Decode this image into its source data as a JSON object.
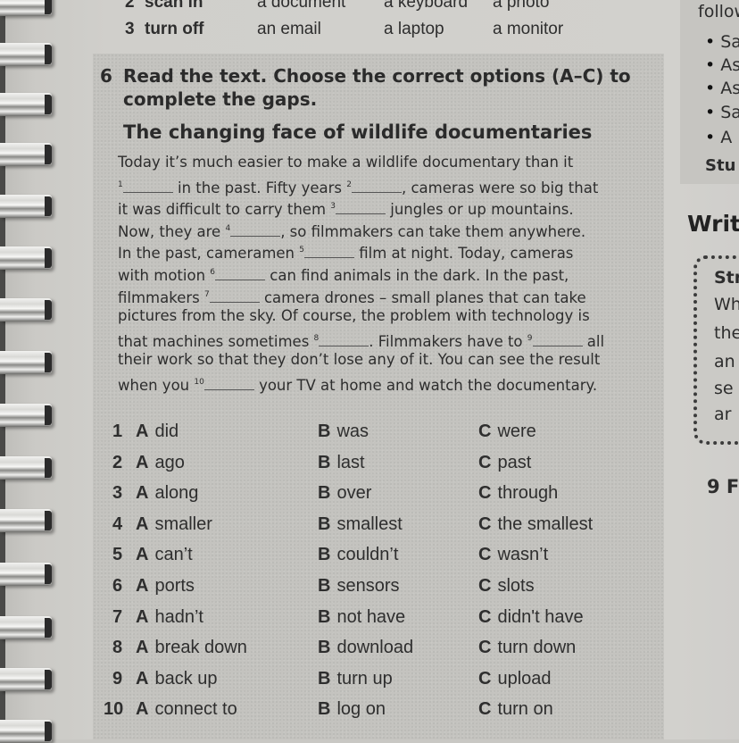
{
  "previous_exercise": {
    "rows": [
      {
        "num": "2",
        "verb": "scan in",
        "options": [
          "a document",
          "a keyboard",
          "a photo"
        ]
      },
      {
        "num": "3",
        "verb": "turn off",
        "options": [
          "an email",
          "a laptop",
          "a monitor"
        ]
      }
    ]
  },
  "exercise": {
    "number": "6",
    "instruction": "Read the text. Choose the correct options (A–C) to complete the gaps.",
    "instruction_line1": "Read the text. Choose the correct options (A–C) to",
    "instruction_line2": "complete the gaps.",
    "article_title": "The changing face of wildlife documentaries",
    "passage_lines": [
      {
        "parts": [
          "Today it’s much easier to make a wildlife documentary than it"
        ]
      },
      {
        "parts": [
          "",
          "1",
          " in the past. Fifty years ",
          "2",
          ", cameras were so big that"
        ]
      },
      {
        "parts": [
          "it was difficult to carry them ",
          "3",
          " jungles or up mountains."
        ]
      },
      {
        "parts": [
          "Now, they are ",
          "4",
          ", so filmmakers can take them anywhere."
        ]
      },
      {
        "parts": [
          "In the past, cameramen ",
          "5",
          " film at night. Today, cameras"
        ]
      },
      {
        "parts": [
          "with motion ",
          "6",
          " can find animals in the dark. In the past,"
        ]
      },
      {
        "parts": [
          "filmmakers ",
          "7",
          " camera drones – small planes that can take"
        ]
      },
      {
        "parts": [
          "pictures from the sky. Of course, the problem with technology is"
        ]
      },
      {
        "parts": [
          "that machines sometimes ",
          "8",
          ". Filmmakers have to ",
          "9",
          " all"
        ]
      },
      {
        "parts": [
          "their work so that they don’t lose any of it. You can see the result"
        ]
      },
      {
        "parts": [
          "when you ",
          "10",
          " your TV at home and watch the documentary."
        ]
      }
    ],
    "options": [
      {
        "num": "1",
        "A": "did",
        "B": "was",
        "C": "were"
      },
      {
        "num": "2",
        "A": "ago",
        "B": "last",
        "C": "past"
      },
      {
        "num": "3",
        "A": "along",
        "B": "over",
        "C": "through"
      },
      {
        "num": "4",
        "A": "smaller",
        "B": "smallest",
        "C": "the smallest"
      },
      {
        "num": "5",
        "A": "can’t",
        "B": "couldn’t",
        "C": "wasn’t"
      },
      {
        "num": "6",
        "A": "ports",
        "B": "sensors",
        "C": "slots"
      },
      {
        "num": "7",
        "A": "hadn’t",
        "B": "not have",
        "C": "didn't have"
      },
      {
        "num": "8",
        "A": "break down",
        "B": "download",
        "C": "turn down"
      },
      {
        "num": "9",
        "A": "back up",
        "B": "turn up",
        "C": "upload"
      },
      {
        "num": "10",
        "A": "connect to",
        "B": "log on",
        "C": "turn on"
      }
    ],
    "letters": {
      "A": "A",
      "B": "B",
      "C": "C"
    }
  },
  "right_column": {
    "top_text": "follow",
    "bullets": [
      "Sa",
      "As",
      "As",
      "Sa",
      "A"
    ],
    "stu": "Stu",
    "write_heading": "Writ",
    "strategy_title": "Str",
    "strategy_lines": [
      "Wh",
      "the",
      "an",
      "se",
      "ar"
    ],
    "next_exercise": "9  F"
  }
}
